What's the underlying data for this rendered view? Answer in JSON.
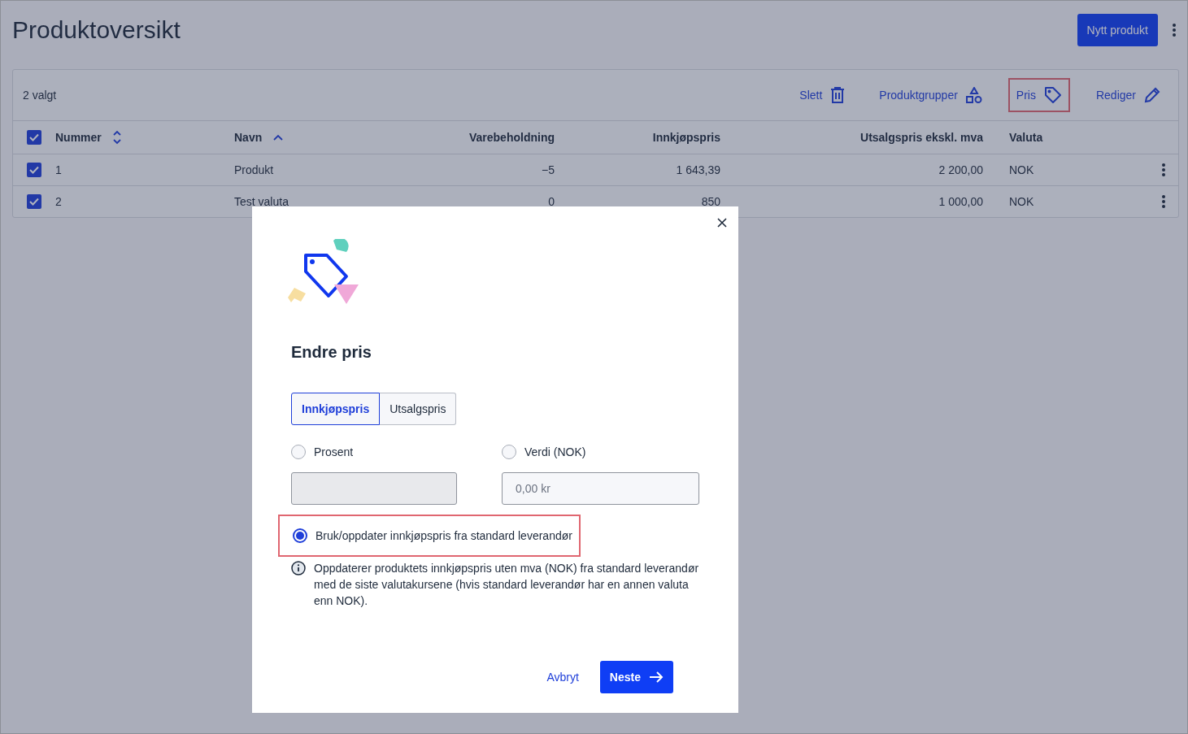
{
  "page": {
    "title": "Produktoversikt",
    "primary_button": "Nytt produkt"
  },
  "toolbar": {
    "selection_count": "2 valgt",
    "actions": [
      {
        "label": "Slett",
        "kind": "delete",
        "highlighted": false
      },
      {
        "label": "Produktgrupper",
        "kind": "groups",
        "highlighted": false
      },
      {
        "label": "Pris",
        "kind": "price",
        "highlighted": true
      },
      {
        "label": "Rediger",
        "kind": "edit",
        "highlighted": false
      }
    ]
  },
  "table": {
    "all_checked": true,
    "columns": [
      {
        "label": "Nummer",
        "kind": "sortable"
      },
      {
        "label": "Navn",
        "kind": "sorted"
      },
      {
        "label": "Varebeholdning",
        "kind": "plain"
      },
      {
        "label": "Innkjøpspris",
        "kind": "plain"
      },
      {
        "label": "Utsalgspris ekskl. mva",
        "kind": "plain"
      },
      {
        "label": "Valuta",
        "kind": "plain"
      }
    ],
    "rows": [
      {
        "checked": true,
        "cells": [
          "1",
          "Produkt",
          "−5",
          "1 643,39",
          "2 200,00",
          "NOK"
        ]
      },
      {
        "checked": true,
        "cells": [
          "2",
          "Test valuta",
          "0",
          "850",
          "1 000,00",
          "NOK"
        ]
      }
    ]
  },
  "dialog": {
    "title": "Endre pris",
    "tabs": [
      {
        "label": "Innkjøpspris",
        "selected": true
      },
      {
        "label": "Utsalgspris",
        "selected": false
      }
    ],
    "options": [
      {
        "label": "Prosent",
        "selected": false
      },
      {
        "label": "Verdi (NOK)",
        "selected": false
      }
    ],
    "fields": [
      {
        "disabled": true
      },
      {
        "disabled": false,
        "placeholder": "0,00 kr"
      }
    ],
    "supplier_option": {
      "label": "Bruk/oppdater innkjøpspris fra standard leverandør",
      "selected": true,
      "highlighted": true
    },
    "info": "Oppdaterer produktets innkjøpspris uten mva (NOK) fra standard leverandør med de siste valutakursene (hvis standard leverandør har en annen valuta enn NOK).",
    "cancel": "Avbryt",
    "next": "Neste"
  }
}
